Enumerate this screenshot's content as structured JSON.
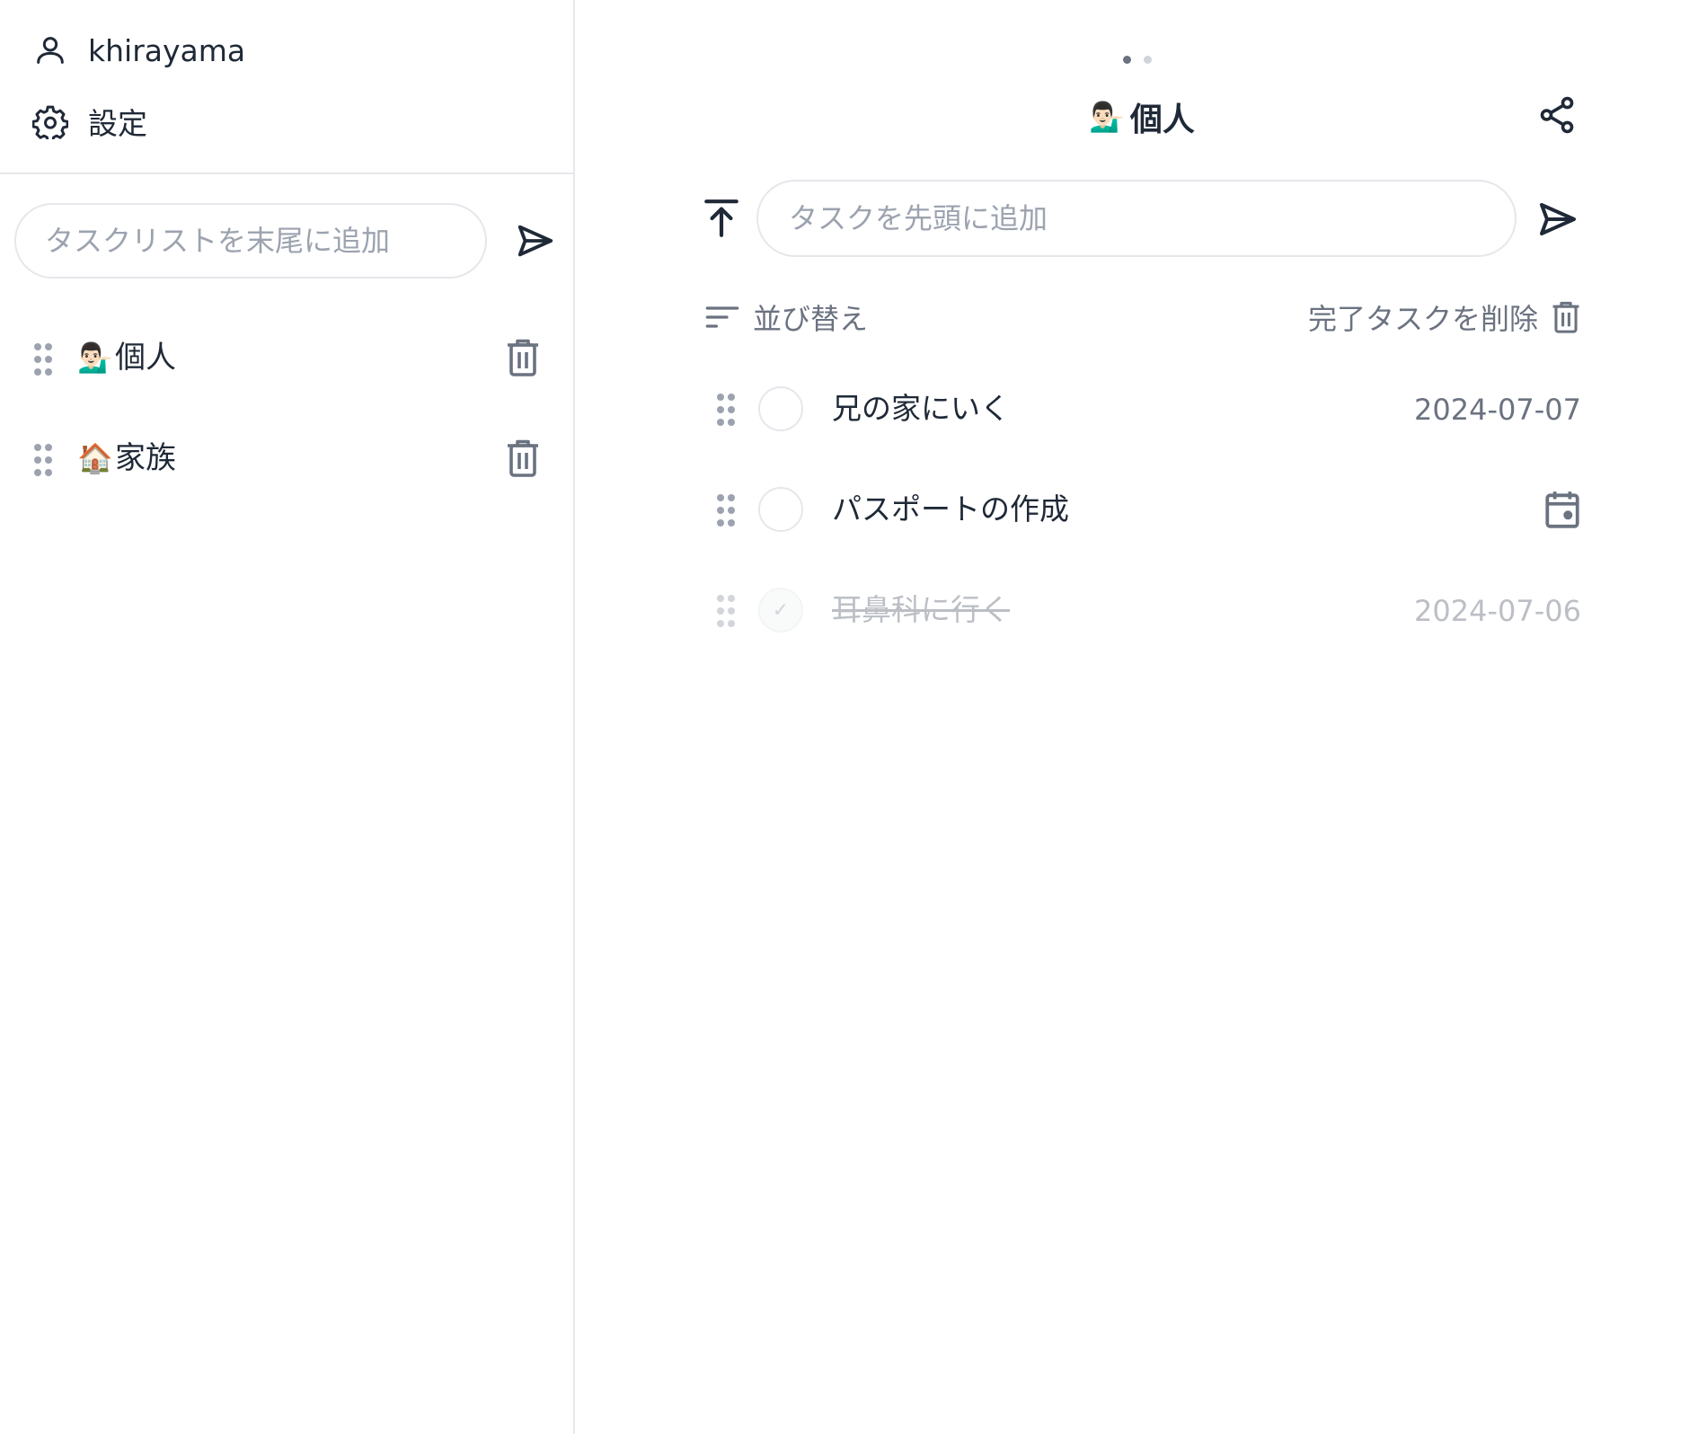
{
  "sidebar": {
    "user_name": "khirayama",
    "settings_label": "設定",
    "add_tasklist_placeholder": "タスクリストを末尾に追加",
    "tasklists": [
      {
        "emoji": "💁🏻‍♂️",
        "name": "個人"
      },
      {
        "emoji": "🏠",
        "name": "家族"
      }
    ]
  },
  "main": {
    "title_emoji": "💁🏻‍♂️",
    "title": "個人",
    "add_task_placeholder": "タスクを先頭に追加",
    "sort_label": "並び替え",
    "clear_completed_label": "完了タスクを削除",
    "tasks": [
      {
        "text": "兄の家にいく",
        "date": "2024-07-07",
        "completed": false
      },
      {
        "text": "パスポートの作成",
        "date": "",
        "completed": false
      },
      {
        "text": "耳鼻科に行く",
        "date": "2024-07-06",
        "completed": true
      }
    ],
    "page_indicator": {
      "current": 1,
      "total": 2
    }
  },
  "icons": {
    "user": "user-icon",
    "settings": "gear-icon",
    "send": "send-icon",
    "drag": "drag-handle-icon",
    "trash": "trash-icon",
    "share": "share-icon",
    "insert_top": "arrow-to-top-icon",
    "sort": "sort-icon",
    "calendar": "calendar-icon"
  },
  "colors": {
    "text": "#1f2937",
    "muted": "#6b7280",
    "placeholder": "#9ca3af",
    "border": "#e5e7eb"
  }
}
